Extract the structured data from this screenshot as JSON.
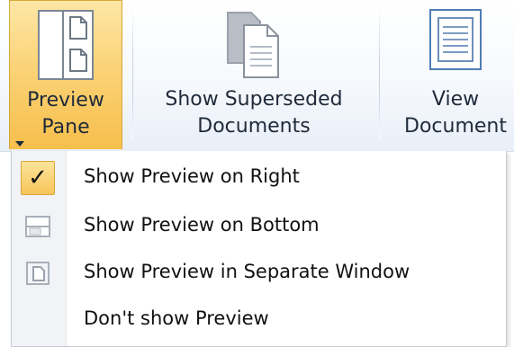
{
  "ribbon": {
    "preview_pane": {
      "line1": "Preview",
      "line2": "Pane",
      "icon": "preview-pane-icon"
    },
    "show_superseded": {
      "line1": "Show Superseded",
      "line2": "Documents",
      "icon": "superseded-documents-icon"
    },
    "view_document": {
      "line1": "View",
      "line2": "Document",
      "icon": "view-document-icon"
    }
  },
  "menu": {
    "items": [
      {
        "label": "Show Preview on Right",
        "checked": true,
        "icon": "checkmark-icon"
      },
      {
        "label": "Show Preview on Bottom",
        "checked": false,
        "icon": "preview-bottom-icon"
      },
      {
        "label": "Show Preview in Separate Window",
        "checked": false,
        "icon": "separate-window-icon"
      },
      {
        "label": "Don't show Preview",
        "checked": false,
        "icon": ""
      }
    ]
  },
  "colors": {
    "highlight": "#f7bf4c",
    "ribbon_bg": "#f6f9fd",
    "menu_gutter": "#f1f3f6"
  }
}
